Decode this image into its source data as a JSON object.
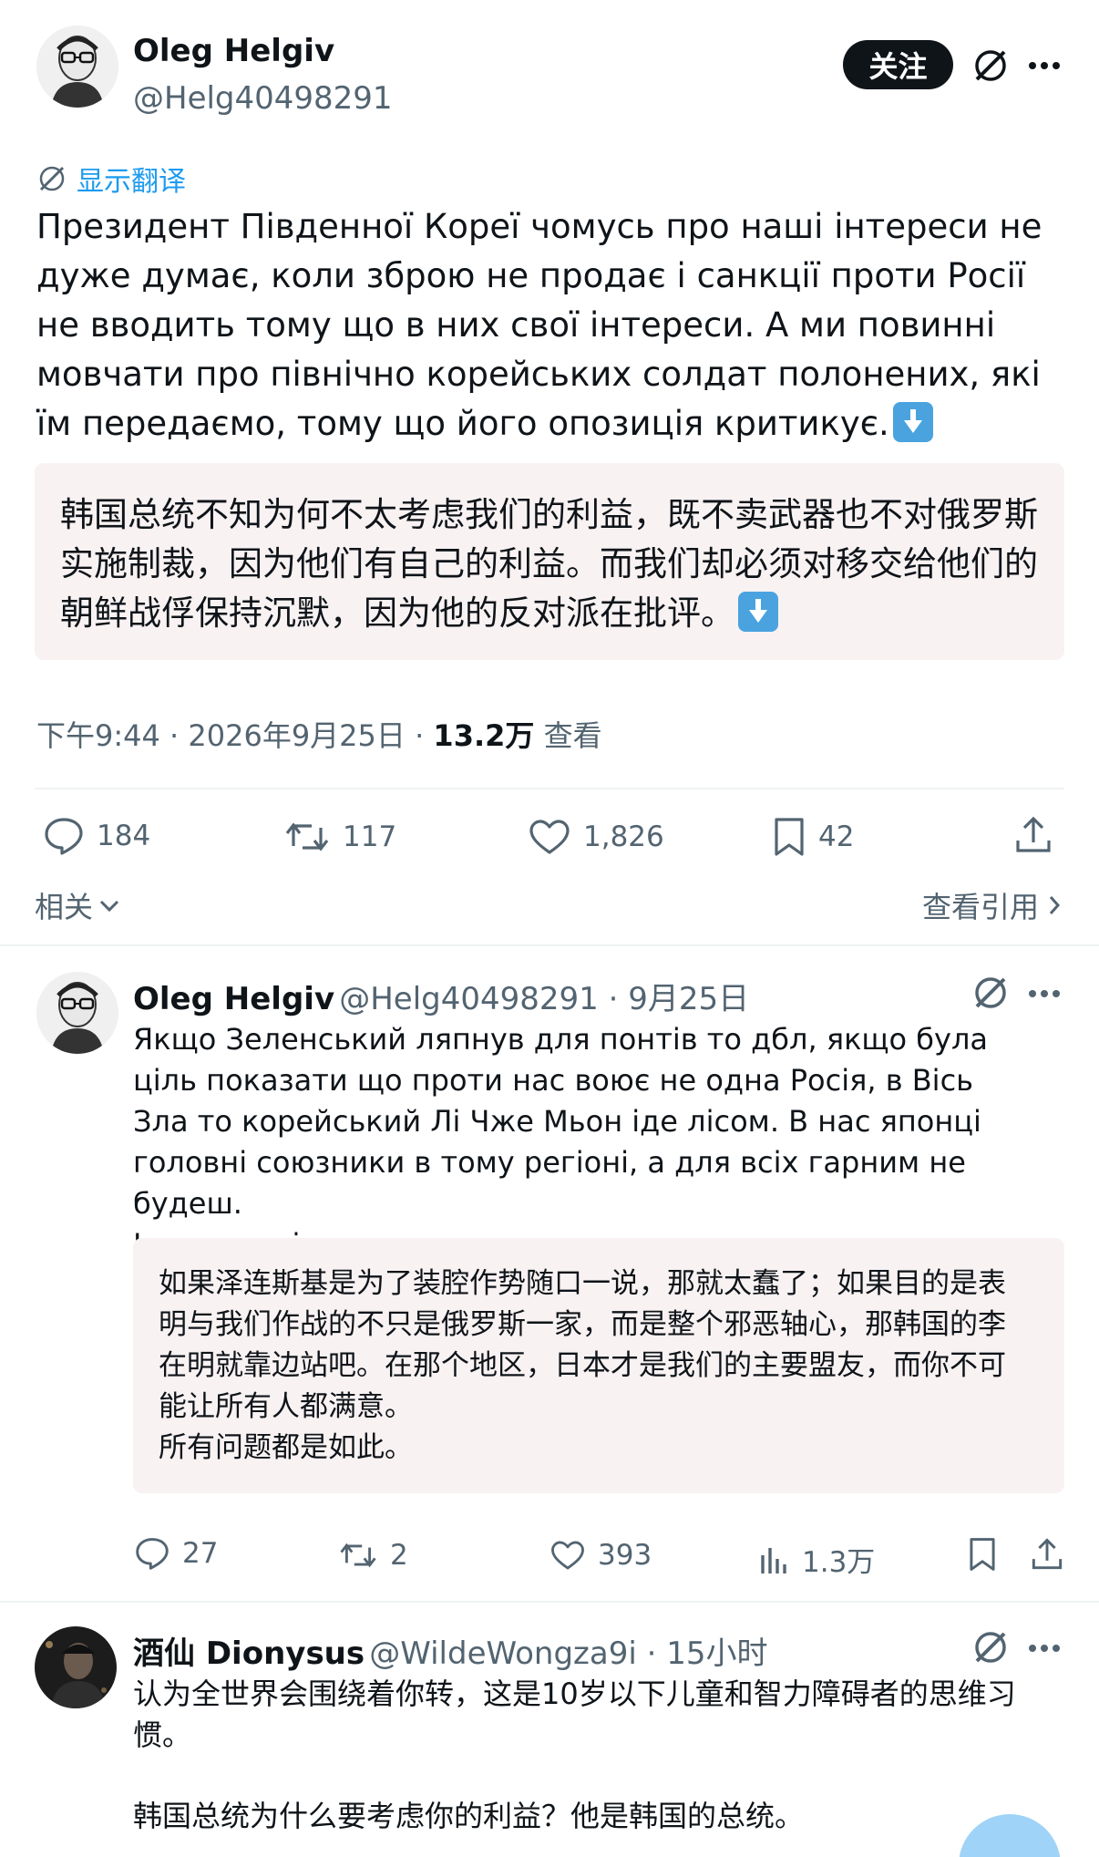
{
  "main_post": {
    "author_name": "Oleg Helgiv",
    "author_handle": "@Helg40498291",
    "follow_label": "关注",
    "translate_label": "显示翻译",
    "text": "Президент Південної Кореї чомусь про наші інтереси не дуже думає, коли зброю не продає і санкції проти Росії не вводить тому що в них свої інтереси. А ми повинні мовчати про північно корейських солдат полонених, які їм передаємо, тому що його опозиція критикує.",
    "translation": "韩国总统不知为何不太考虑我们的利益，既不卖武器也不对俄罗斯实施制裁，因为他们有自己的利益。而我们却必须对移交给他们的朝鲜战俘保持沉默，因为他的反对派在批评。",
    "time": "下午9:44 · 2026年9月25日 · ",
    "views_count": "13.2万",
    "views_label": " 查看",
    "replies": "184",
    "reposts": "117",
    "likes": "1,826",
    "bookmarks": "42",
    "related_label": "相关",
    "quotes_label": "查看引用"
  },
  "reply1": {
    "author_name": "Oleg Helgiv",
    "author_handle": "@Helg40498291",
    "time": " · 9月25日",
    "text": "Якщо Зеленський ляпнув для понтів то дбл, якщо була ціль показати що проти нас воює не одна Росія, в Вісь Зла то корейський Лі Чже Мьон іде лісом. В нас японці головні союзники в тому регіоні, а для всіх гарним не будеш.\nІ так по всім питанням.",
    "translation": "如果泽连斯基是为了装腔作势随口一说，那就太蠢了；如果目的是表明与我们作战的不只是俄罗斯一家，而是整个邪恶轴心，那韩国的李在明就靠边站吧。在那个地区，日本才是我们的主要盟友，而你不可能让所有人都满意。\n所有问题都是如此。",
    "replies": "27",
    "reposts": "2",
    "likes": "393",
    "views": "1.3万"
  },
  "reply2": {
    "author_name": "酒仙 Dionysus",
    "author_handle": "@WildeWongza9i",
    "time": " · 15小时",
    "text_line1": "认为全世界会围绕着你转，这是10岁以下儿童和智力障碍者的思维习惯。",
    "text_line2": "韩国总统为什么要考虑你的利益？他是韩国的总统。"
  }
}
